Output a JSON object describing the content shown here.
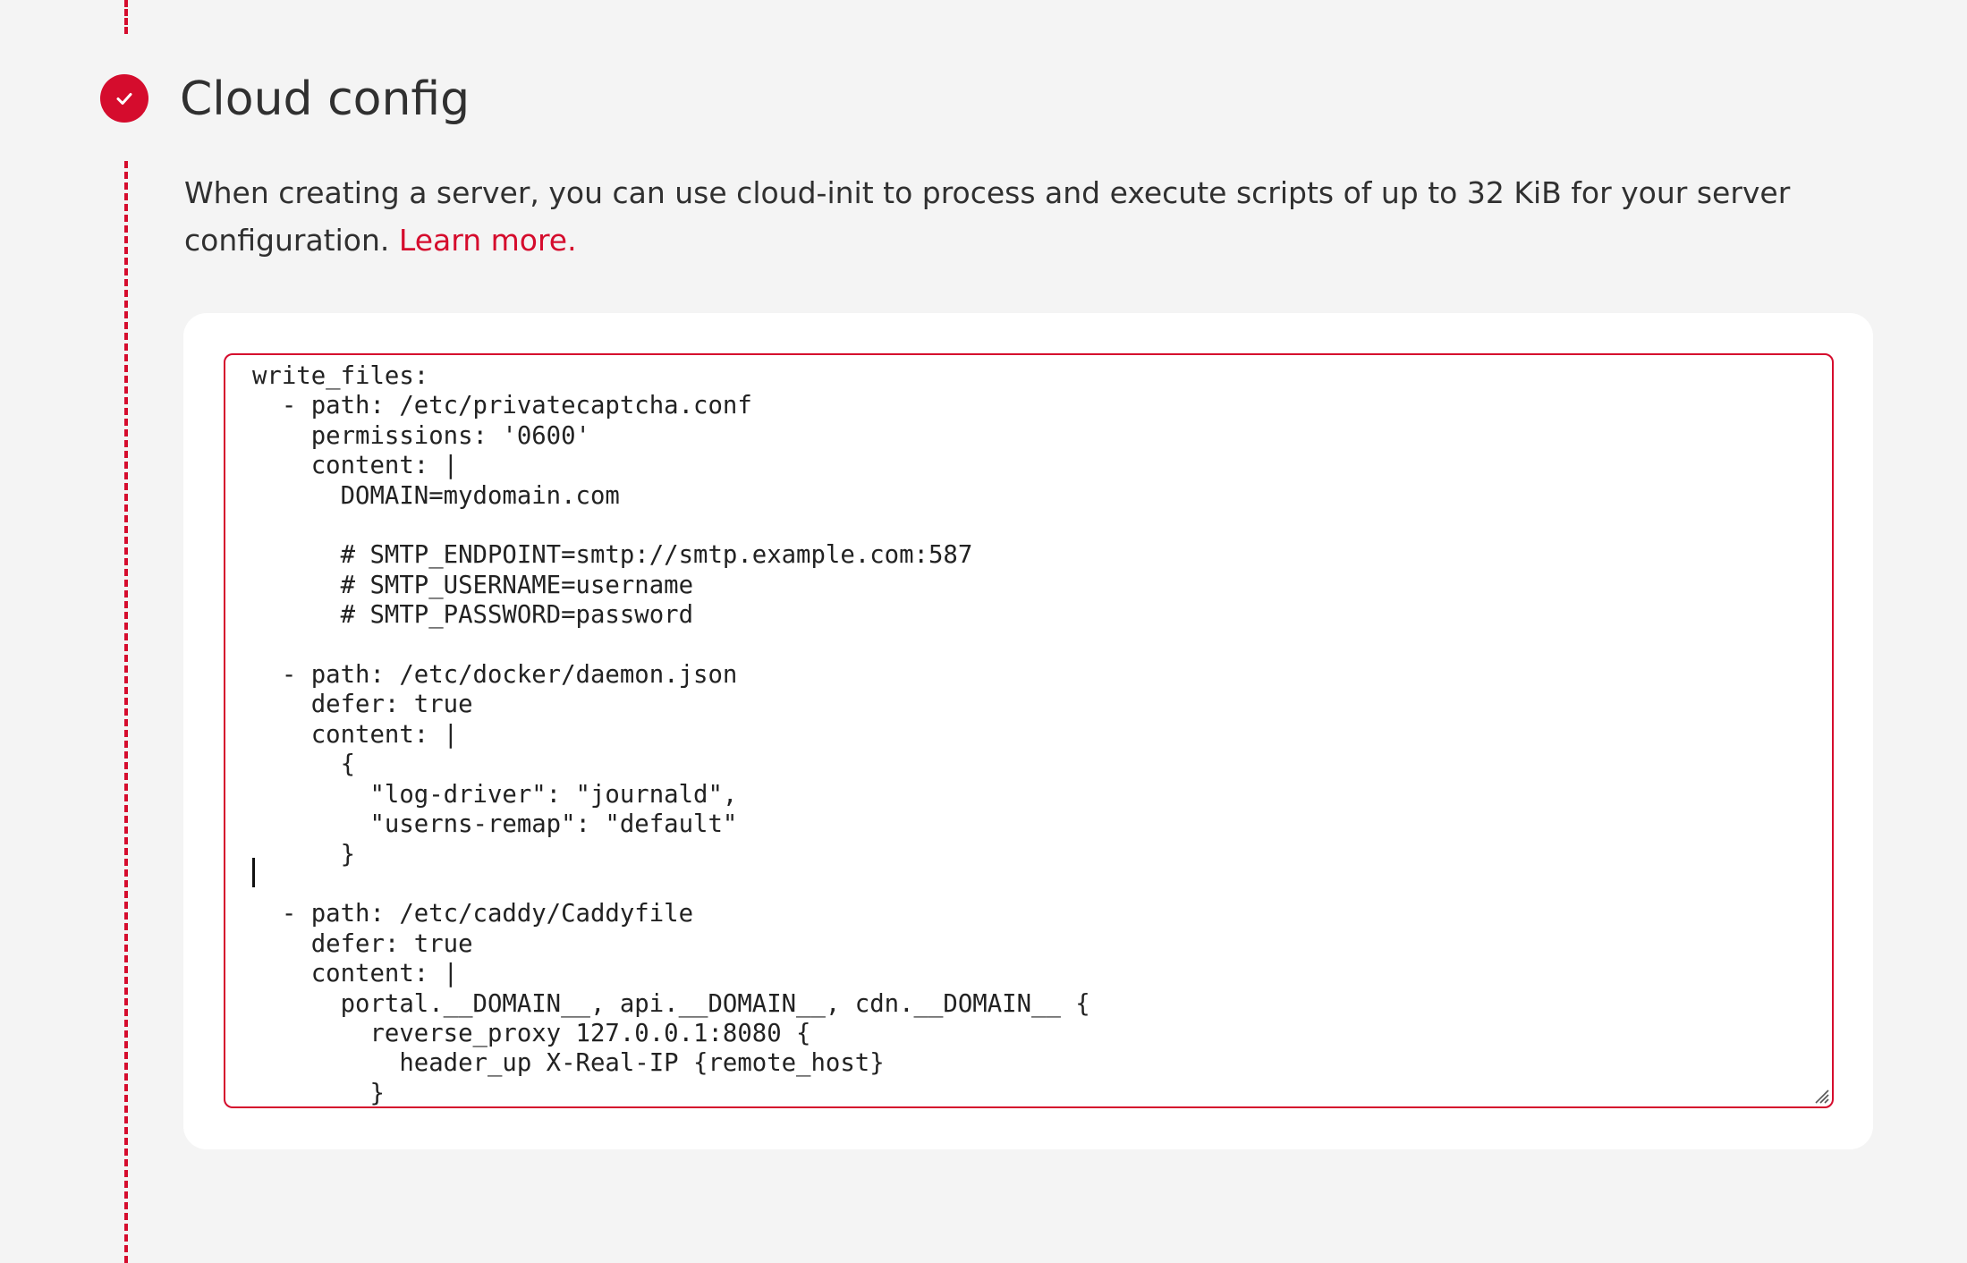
{
  "section": {
    "title": "Cloud config",
    "status_icon": "check-circle-icon",
    "description": "When creating a server, you can use cloud-init to process and execute scripts of up to 32 KiB for your server configuration.",
    "learn_more_label": "Learn more."
  },
  "editor": {
    "content": "write_files:\n  - path: /etc/privatecaptcha.conf\n    permissions: '0600'\n    content: |\n      DOMAIN=mydomain.com\n\n      # SMTP_ENDPOINT=smtp://smtp.example.com:587\n      # SMTP_USERNAME=username\n      # SMTP_PASSWORD=password\n\n  - path: /etc/docker/daemon.json\n    defer: true\n    content: |\n      {\n        \"log-driver\": \"journald\",\n        \"userns-remap\": \"default\"\n      }\n\n  - path: /etc/caddy/Caddyfile\n    defer: true\n    content: |\n      portal.__DOMAIN__, api.__DOMAIN__, cdn.__DOMAIN__ {\n        reverse_proxy 127.0.0.1:8080 {\n          header_up X-Real-IP {remote_host}\n        }"
  },
  "colors": {
    "accent": "#d50c2d",
    "page_background": "#f4f4f4",
    "card_background": "#ffffff",
    "text": "#303030"
  }
}
